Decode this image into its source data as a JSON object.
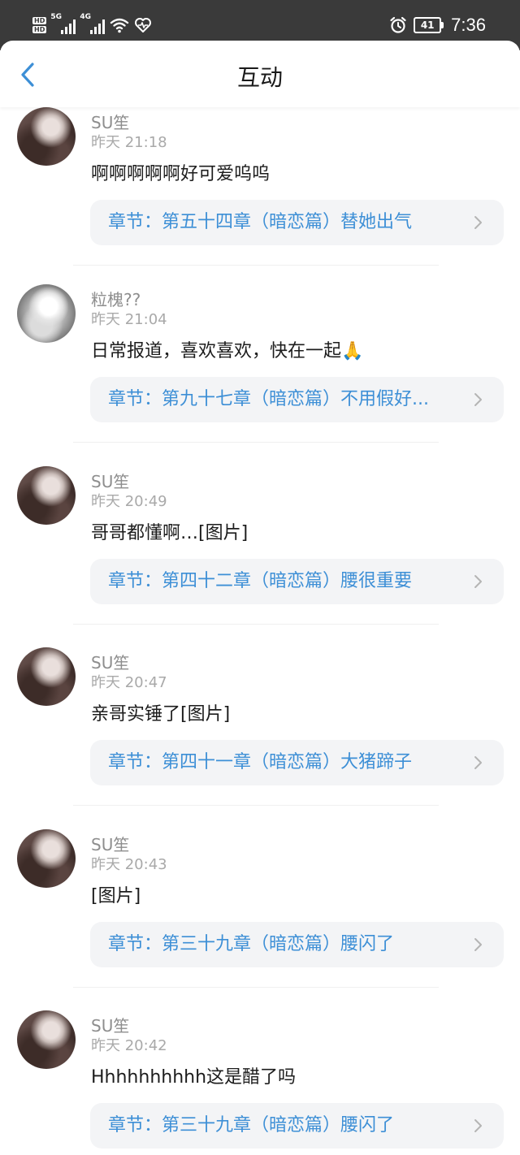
{
  "status_bar": {
    "hd_labels": [
      "HD",
      "HD"
    ],
    "network_5g": "5G",
    "network_4g": "4G",
    "battery": "41",
    "time": "7:36"
  },
  "header": {
    "title": "互动",
    "back_icon": "chevron-left-icon"
  },
  "colors": {
    "accent": "#3d8fd6",
    "card_bg": "#f3f4f6",
    "status_bar_bg": "#3a3a3a"
  },
  "items": [
    {
      "username": "SU笙",
      "time": "昨天 21:18",
      "comment": "啊啊啊啊啊好可爱呜呜",
      "chapter": "章节：第五十四章（暗恋篇）替她出气"
    },
    {
      "username": "粒槐??",
      "time": "昨天 21:04",
      "comment": "日常报道，喜欢喜欢，快在一起🙏",
      "chapter": "章节：第九十七章（暗恋篇）不用假好..."
    },
    {
      "username": "SU笙",
      "time": "昨天 20:49",
      "comment": "哥哥都懂啊…[图片]",
      "chapter": "章节：第四十二章（暗恋篇）腰很重要"
    },
    {
      "username": "SU笙",
      "time": "昨天 20:47",
      "comment": "亲哥实锤了[图片]",
      "chapter": "章节：第四十一章（暗恋篇）大猪蹄子"
    },
    {
      "username": "SU笙",
      "time": "昨天 20:43",
      "comment": "[图片]",
      "chapter": "章节：第三十九章（暗恋篇）腰闪了"
    },
    {
      "username": "SU笙",
      "time": "昨天 20:42",
      "comment": "Hhhhhhhhhh这是醋了吗",
      "chapter": "章节：第三十九章（暗恋篇）腰闪了"
    }
  ]
}
